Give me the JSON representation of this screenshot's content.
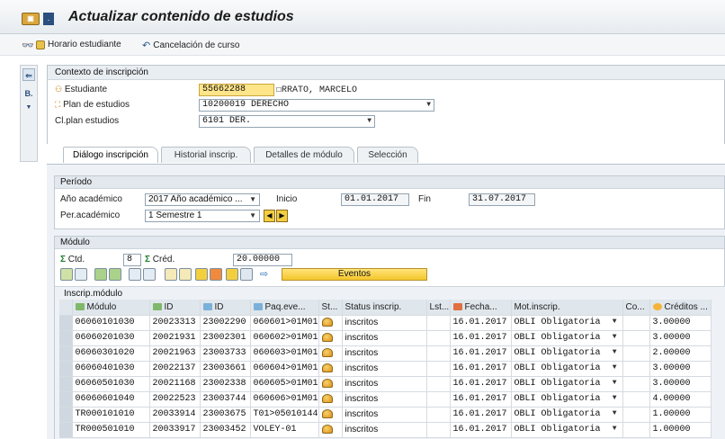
{
  "title": "Actualizar contenido de estudios",
  "toolbar": {
    "horario_label": "Horario estudiante",
    "cancelacion_label": "Cancelación de curso"
  },
  "left_strip": {
    "item_b": "B."
  },
  "context": {
    "header": "Contexto de inscripción",
    "estudiante_label": "Estudiante",
    "estudiante_id": "55662288",
    "estudiante_name": "RRATO, MARCELO",
    "plan_label": "Plan de estudios",
    "plan_value": "10200019 DERECHO",
    "clplan_label": "Cl.plan estudios",
    "clplan_value": "6101 DER."
  },
  "tabs": [
    {
      "label": "Diálogo inscripción",
      "active": true
    },
    {
      "label": "Historial inscrip.",
      "active": false
    },
    {
      "label": "Detalles de módulo",
      "active": false
    },
    {
      "label": "Selección",
      "active": false
    }
  ],
  "periodo": {
    "header": "Período",
    "ano_label": "Año académico",
    "ano_value": "2017 Año académico ...",
    "inicio_label": "Inicio",
    "inicio_value": "01.01.2017",
    "fin_label": "Fin",
    "fin_value": "31.07.2017",
    "per_label": "Per.académico",
    "per_value": "1 Semestre 1"
  },
  "modulo": {
    "header": "Módulo",
    "ctd_label": "Ctd.",
    "ctd_value": "8",
    "cred_label": "Créd.",
    "cred_value": "20.00000",
    "eventos_label": "Eventos",
    "table_title": "Inscrip.módulo"
  },
  "table": {
    "columns": [
      "Módulo",
      "ID",
      "ID",
      "Paq.eve...",
      "St...",
      "Status inscrip.",
      "Lst...",
      "Fecha...",
      "Mot.inscrip.",
      "Co...",
      "Créditos ..."
    ],
    "rows": [
      {
        "modulo": "06060101030",
        "id1": "20023313",
        "id2": "23002290",
        "paq": "060601>01M01",
        "status": "inscritos",
        "fecha": "16.01.2017",
        "mot": "OBLI Obligatoria",
        "creditos": "3.00000"
      },
      {
        "modulo": "06060201030",
        "id1": "20021931",
        "id2": "23002301",
        "paq": "060602>01M01",
        "status": "inscritos",
        "fecha": "16.01.2017",
        "mot": "OBLI Obligatoria",
        "creditos": "3.00000"
      },
      {
        "modulo": "06060301020",
        "id1": "20021963",
        "id2": "23003733",
        "paq": "060603>01M01",
        "status": "inscritos",
        "fecha": "16.01.2017",
        "mot": "OBLI Obligatoria",
        "creditos": "2.00000"
      },
      {
        "modulo": "06060401030",
        "id1": "20022137",
        "id2": "23003661",
        "paq": "060604>01M01",
        "status": "inscritos",
        "fecha": "16.01.2017",
        "mot": "OBLI Obligatoria",
        "creditos": "3.00000"
      },
      {
        "modulo": "06060501030",
        "id1": "20021168",
        "id2": "23002338",
        "paq": "060605>01M01",
        "status": "inscritos",
        "fecha": "16.01.2017",
        "mot": "OBLI Obligatoria",
        "creditos": "3.00000"
      },
      {
        "modulo": "06060601040",
        "id1": "20022523",
        "id2": "23003744",
        "paq": "060606>01M01",
        "status": "inscritos",
        "fecha": "16.01.2017",
        "mot": "OBLI Obligatoria",
        "creditos": "4.00000"
      },
      {
        "modulo": "TR000101010",
        "id1": "20033914",
        "id2": "23003675",
        "paq": "T01>05010144",
        "status": "inscritos",
        "fecha": "16.01.2017",
        "mot": "OBLI Obligatoria",
        "creditos": "1.00000"
      },
      {
        "modulo": "TR000501010",
        "id1": "20033917",
        "id2": "23003452",
        "paq": "VOLEY-01",
        "status": "inscritos",
        "fecha": "16.01.2017",
        "mot": "OBLI Obligatoria",
        "creditos": "1.00000"
      }
    ]
  },
  "colors": {
    "accent": "#f4c62b",
    "highlight_field": "#ffe58a",
    "header_bg": "#dfe6ec"
  }
}
